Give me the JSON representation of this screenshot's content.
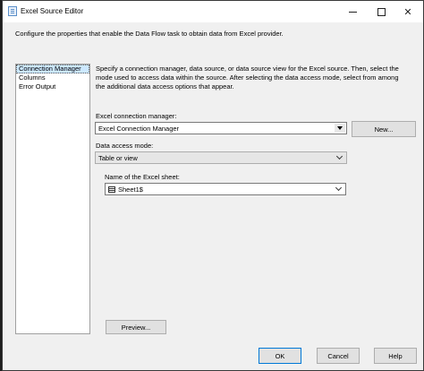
{
  "window": {
    "title": "Excel Source Editor",
    "close_glyph": "✕"
  },
  "description": "Configure the properties that enable the Data Flow task to obtain data from Excel provider.",
  "nav": {
    "items": [
      {
        "label": "Connection Manager",
        "selected": true
      },
      {
        "label": "Columns",
        "selected": false
      },
      {
        "label": "Error Output",
        "selected": false
      }
    ]
  },
  "connection_manager": {
    "intro": "Specify a connection manager, data source, or data source view for the Excel source. Then, select the mode used to access data within the source. After selecting the data access mode, select from among the additional data access options that appear.",
    "excel_connection_label": "Excel connection manager:",
    "excel_connection_value": "Excel Connection Manager",
    "new_button": "New...",
    "data_access_mode_label": "Data access mode:",
    "data_access_mode_value": "Table or view",
    "sheet_label": "Name of the Excel sheet:",
    "sheet_value": "Sheet1$",
    "preview_button": "Preview..."
  },
  "footer": {
    "ok": "OK",
    "cancel": "Cancel",
    "help": "Help"
  },
  "colors": {
    "selection": "#cce8ff",
    "accent_border": "#0078d7"
  }
}
